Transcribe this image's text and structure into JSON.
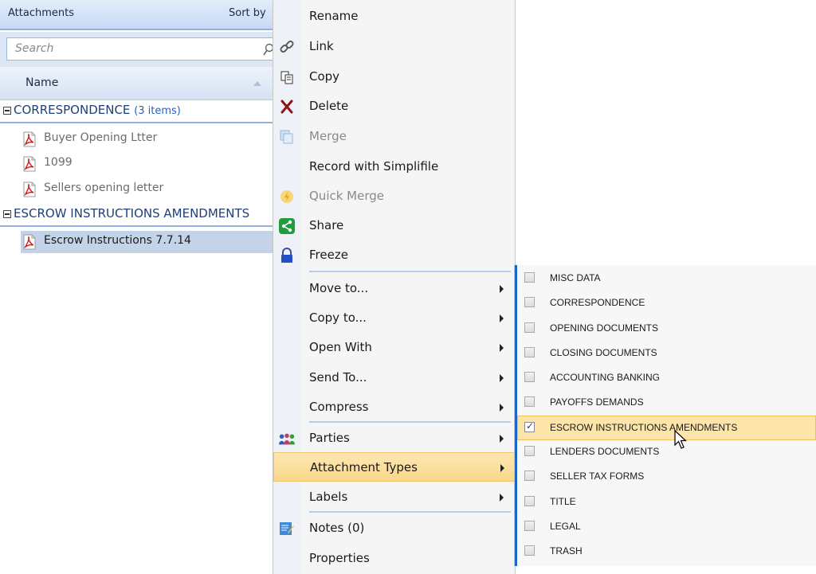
{
  "panel": {
    "title": "Attachments",
    "sort_label": "Sort by",
    "search_placeholder": "Search",
    "column_name": "Name",
    "groups": [
      {
        "label": "CORRESPONDENCE",
        "count": "(3 items)",
        "files": [
          "Buyer Opening Ltter",
          "1099",
          "Sellers opening letter"
        ]
      },
      {
        "label": "ESCROW INSTRUCTIONS  AMENDMENTS",
        "count": "",
        "files": [
          "Escrow Instructions 7.7.14"
        ]
      }
    ]
  },
  "menu": {
    "items": [
      {
        "label": "Rename",
        "icon": "",
        "disabled": false,
        "submenu": false
      },
      {
        "label": "Link",
        "icon": "link-icon",
        "disabled": false,
        "submenu": false
      },
      {
        "label": "Copy",
        "icon": "copy-icon",
        "disabled": false,
        "submenu": false
      },
      {
        "label": "Delete",
        "icon": "delete-x-icon",
        "disabled": false,
        "submenu": false
      },
      {
        "label": "Merge",
        "icon": "merge-icon",
        "disabled": true,
        "submenu": false
      },
      {
        "label": "Record with Simplifile",
        "icon": "",
        "disabled": false,
        "submenu": false
      },
      {
        "label": "Quick Merge",
        "icon": "lightning-icon",
        "disabled": true,
        "submenu": false
      },
      {
        "label": "Share",
        "icon": "share-icon",
        "disabled": false,
        "submenu": false
      },
      {
        "label": "Freeze",
        "icon": "lock-icon",
        "disabled": false,
        "submenu": false
      },
      {
        "label": "Move to...",
        "icon": "",
        "disabled": false,
        "submenu": true
      },
      {
        "label": "Copy to...",
        "icon": "",
        "disabled": false,
        "submenu": true
      },
      {
        "label": "Open With",
        "icon": "",
        "disabled": false,
        "submenu": true
      },
      {
        "label": "Send To...",
        "icon": "",
        "disabled": false,
        "submenu": true
      },
      {
        "label": "Compress",
        "icon": "",
        "disabled": false,
        "submenu": true
      },
      {
        "label": "Parties",
        "icon": "people-icon",
        "disabled": false,
        "submenu": true
      },
      {
        "label": "Attachment Types",
        "icon": "",
        "disabled": false,
        "submenu": true
      },
      {
        "label": "Labels",
        "icon": "",
        "disabled": false,
        "submenu": true
      },
      {
        "label": "Notes (0)",
        "icon": "notes-icon",
        "disabled": false,
        "submenu": false
      },
      {
        "label": "Properties",
        "icon": "",
        "disabled": false,
        "submenu": false
      }
    ]
  },
  "submenu": {
    "items": [
      {
        "label": "MISC DATA",
        "checked": false
      },
      {
        "label": "CORRESPONDENCE",
        "checked": false
      },
      {
        "label": "OPENING DOCUMENTS",
        "checked": false
      },
      {
        "label": "CLOSING DOCUMENTS",
        "checked": false
      },
      {
        "label": "ACCOUNTING BANKING",
        "checked": false
      },
      {
        "label": "PAYOFFS DEMANDS",
        "checked": false
      },
      {
        "label": "ESCROW INSTRUCTIONS  AMENDMENTS",
        "checked": true
      },
      {
        "label": "LENDERS DOCUMENTS",
        "checked": false
      },
      {
        "label": "SELLER TAX FORMS",
        "checked": false
      },
      {
        "label": "TITLE",
        "checked": false
      },
      {
        "label": "LEGAL",
        "checked": false
      },
      {
        "label": "TRASH",
        "checked": false
      }
    ]
  },
  "colors": {
    "accent": "#1e66c4",
    "hover": "#fde4a8",
    "group_text": "#1f3f7a"
  }
}
